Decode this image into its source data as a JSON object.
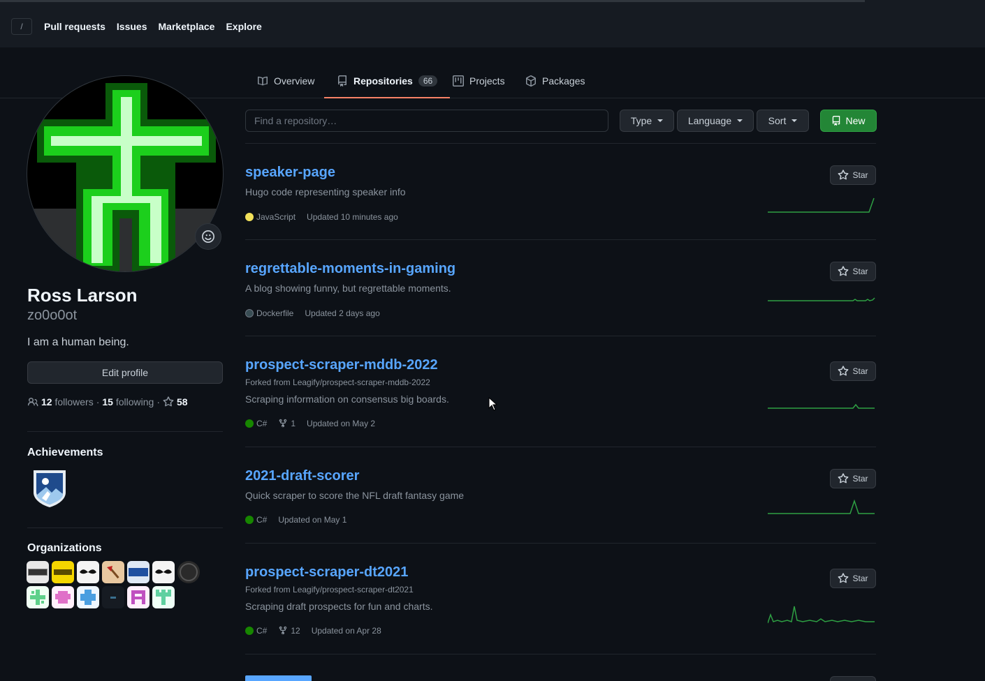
{
  "header": {
    "slash_key": "/",
    "nav": [
      "Pull requests",
      "Issues",
      "Marketplace",
      "Explore"
    ]
  },
  "tabs": [
    {
      "label": "Overview",
      "icon": "book-icon"
    },
    {
      "label": "Repositories",
      "icon": "repo-icon",
      "count": "66",
      "active": true
    },
    {
      "label": "Projects",
      "icon": "project-icon"
    },
    {
      "label": "Packages",
      "icon": "package-icon"
    }
  ],
  "profile": {
    "name": "Ross Larson",
    "username": "zo0o0ot",
    "bio": "I am a human being.",
    "edit_label": "Edit profile",
    "followers_count": "12",
    "followers_label": "followers",
    "following_count": "15",
    "following_label": "following",
    "stars_count": "58",
    "separator": "·"
  },
  "achievements": {
    "title": "Achievements"
  },
  "organizations": {
    "title": "Organizations"
  },
  "toolbar": {
    "search_placeholder": "Find a repository…",
    "type_label": "Type",
    "language_label": "Language",
    "sort_label": "Sort",
    "new_label": "New"
  },
  "repos": [
    {
      "name": "speaker-page",
      "description": "Hugo code representing speaker info",
      "language": "JavaScript",
      "lang_color": "#f1e05a",
      "updated": "Updated 10 minutes ago",
      "star_label": "Star"
    },
    {
      "name": "regrettable-moments-in-gaming",
      "description": "A blog showing funny, but regrettable moments.",
      "language": "Dockerfile",
      "lang_color": "#384d54",
      "updated": "Updated 2 days ago",
      "star_label": "Star"
    },
    {
      "name": "prospect-scraper-mddb-2022",
      "forked_from": "Forked from Leagify/prospect-scraper-mddb-2022",
      "description": "Scraping information on consensus big boards.",
      "language": "C#",
      "lang_color": "#178600",
      "forks": "1",
      "updated": "Updated on May 2",
      "star_label": "Star"
    },
    {
      "name": "2021-draft-scorer",
      "description": "Quick scraper to score the NFL draft fantasy game",
      "language": "C#",
      "lang_color": "#178600",
      "updated": "Updated on May 1",
      "star_label": "Star"
    },
    {
      "name": "prospect-scraper-dt2021",
      "forked_from": "Forked from Leagify/prospect-scraper-dt2021",
      "description": "Scraping draft prospects for fun and charts.",
      "language": "C#",
      "lang_color": "#178600",
      "forks": "12",
      "updated": "Updated on Apr 28",
      "star_label": "Star"
    }
  ],
  "colors": {
    "accent": "#58a6ff",
    "new_button": "#238636",
    "tab_underline": "#f78166",
    "sparkline": "#2ea043"
  }
}
